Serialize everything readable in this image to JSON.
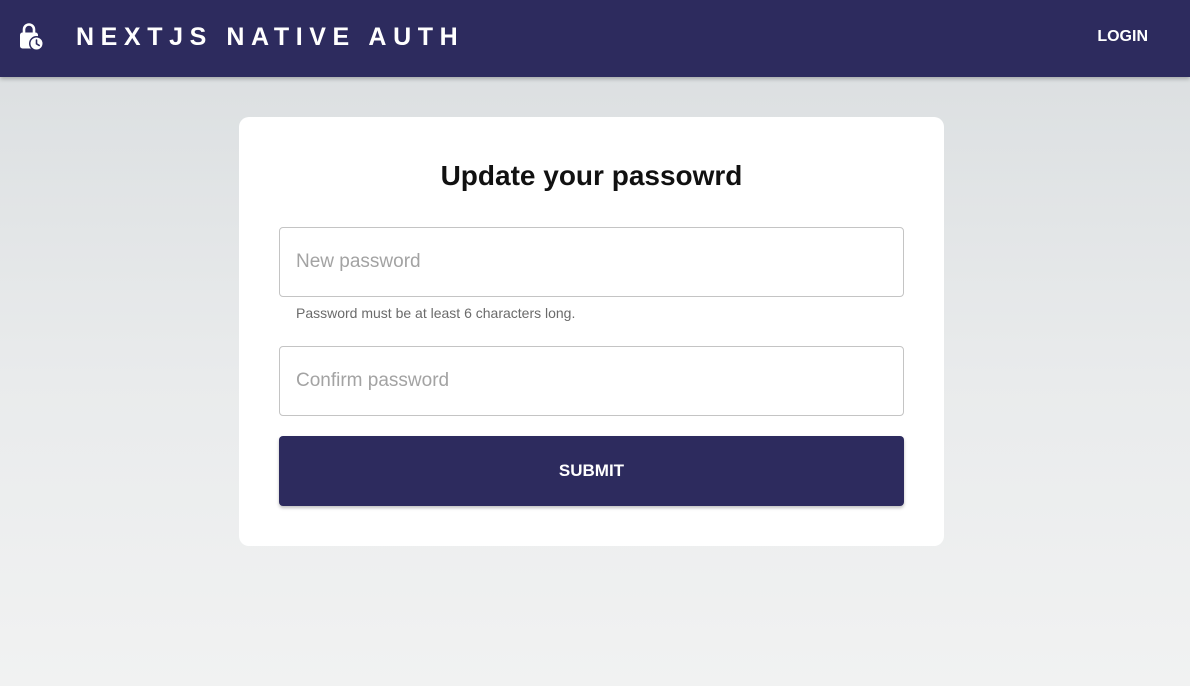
{
  "header": {
    "brand_icon": "lock-clock-icon",
    "title": "NEXTJS NATIVE AUTH",
    "login_label": "LOGIN",
    "background": "#2d2b5e"
  },
  "form": {
    "title": "Update your passowrd",
    "new_password": {
      "placeholder": "New password",
      "value": "",
      "helper": "Password must be at least 6 characters long."
    },
    "confirm_password": {
      "placeholder": "Confirm password",
      "value": ""
    },
    "submit_label": "SUBMIT",
    "submit_color": "#2d2b5e"
  }
}
